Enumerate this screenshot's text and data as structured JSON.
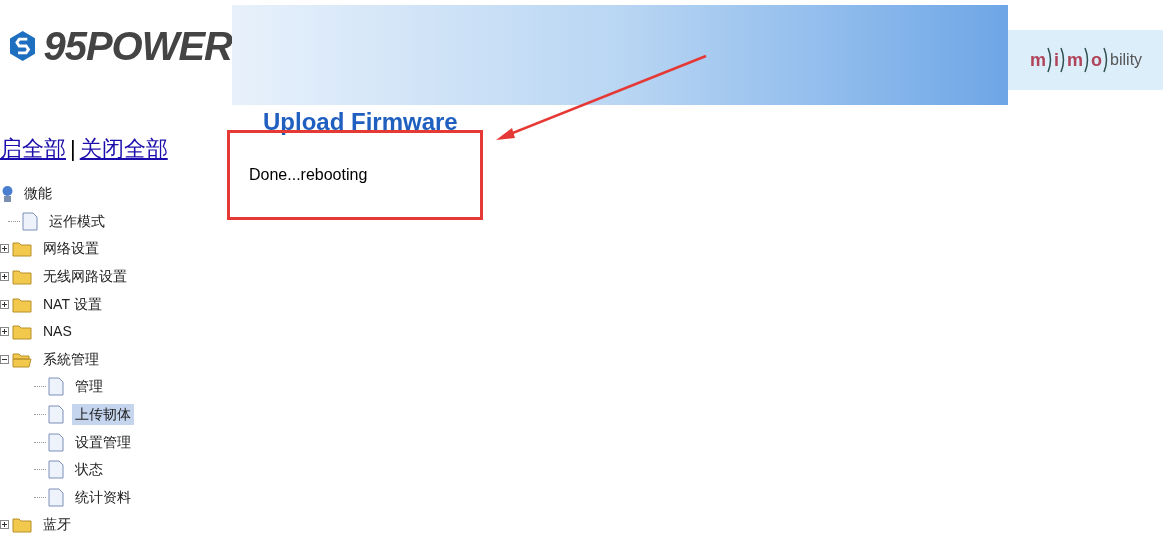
{
  "header": {
    "logo_text": "95POWER",
    "partner_logo": {
      "letters": [
        "m",
        "i",
        "m",
        "o"
      ],
      "suffix": "bility"
    }
  },
  "sidebar": {
    "links": [
      "启全部",
      "关闭全部"
    ],
    "separator": "|",
    "tree": {
      "label": "微能",
      "kind": "root",
      "children": [
        {
          "label": "运作模式",
          "kind": "page",
          "selected": false
        },
        {
          "label": "网络设置",
          "kind": "folder",
          "expanded": false,
          "selected": false
        },
        {
          "label": "无线网路设置",
          "kind": "folder",
          "expanded": false,
          "selected": false
        },
        {
          "label": "NAT 设置",
          "kind": "folder",
          "expanded": false,
          "selected": false
        },
        {
          "label": "NAS",
          "kind": "folder",
          "expanded": false,
          "selected": false
        },
        {
          "label": "系統管理",
          "kind": "folder",
          "expanded": true,
          "selected": false,
          "children": [
            {
              "label": "管理",
              "kind": "page",
              "selected": false
            },
            {
              "label": "上传韧体",
              "kind": "page",
              "selected": true
            },
            {
              "label": "设置管理",
              "kind": "page",
              "selected": false
            },
            {
              "label": "状态",
              "kind": "page",
              "selected": false
            },
            {
              "label": "统计资料",
              "kind": "page",
              "selected": false
            }
          ]
        },
        {
          "label": "蓝牙",
          "kind": "folder",
          "expanded": false,
          "selected": false
        }
      ]
    }
  },
  "main": {
    "title": "Upload Firmware",
    "message": "Done...rebooting"
  }
}
